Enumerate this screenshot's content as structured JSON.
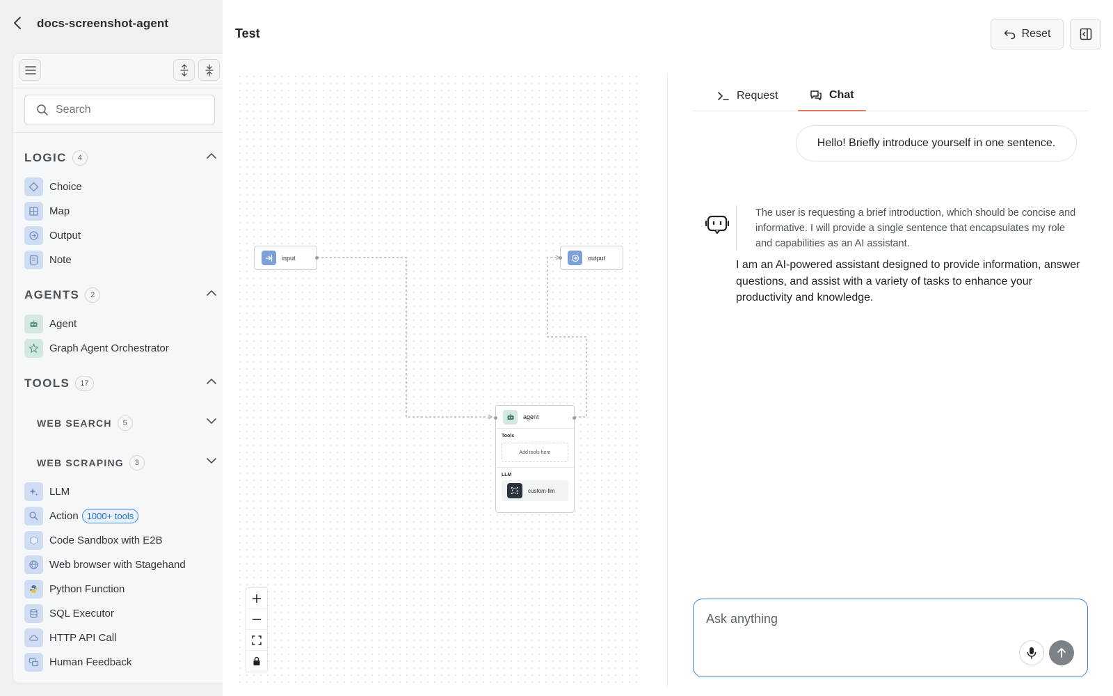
{
  "header": {
    "app_title": "docs-screenshot-agent",
    "page_title": "Test",
    "reset_label": "Reset"
  },
  "sidebar": {
    "search_placeholder": "Search",
    "sections": {
      "logic": {
        "title": "LOGIC",
        "count": "4"
      },
      "agents": {
        "title": "AGENTS",
        "count": "2"
      },
      "tools": {
        "title": "TOOLS",
        "count": "17"
      },
      "web_search": {
        "title": "WEB SEARCH",
        "count": "5"
      },
      "web_scraping": {
        "title": "WEB SCRAPING",
        "count": "3"
      }
    },
    "logic_items": [
      "Choice",
      "Map",
      "Output",
      "Note"
    ],
    "agent_items": [
      "Agent",
      "Graph Agent Orchestrator"
    ],
    "tool_items": [
      "LLM",
      "Action",
      "Code Sandbox with E2B",
      "Web browser with Stagehand",
      "Python Function",
      "SQL Executor",
      "HTTP API Call",
      "Human Feedback"
    ],
    "action_tag": "1000+ tools"
  },
  "canvas": {
    "input_node": "input",
    "output_node": "output",
    "agent_node": {
      "title": "agent",
      "tools_label": "Tools",
      "add_tools": "Add tools here",
      "llm_label": "LLM",
      "llm_name": "custom-llm"
    }
  },
  "chat": {
    "tabs": [
      "Request",
      "Chat"
    ],
    "active_tab": "Chat",
    "user_message": "Hello! Briefly introduce yourself in one sentence.",
    "thinking": "The user is requesting a brief introduction, which should be concise and informative. I will provide a single sentence that encapsulates my role and capabilities as an AI assistant.",
    "answer": "I am an AI-powered assistant designed to provide information, answer questions, and assist with a variety of tasks to enhance your productivity and knowledge.",
    "input_placeholder": "Ask anything"
  },
  "colors": {
    "accent_blue": "#3d84de",
    "active_tab_underline": "#e07a5f",
    "logic_icon_bg": "#cfdcf1",
    "agent_icon_bg": "#d3e8df"
  }
}
